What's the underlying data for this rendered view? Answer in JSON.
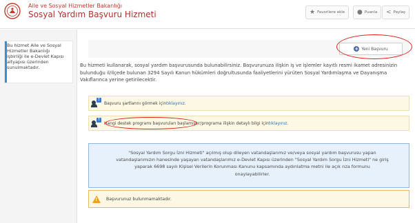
{
  "header": {
    "ministry": "Aile ve Sosyal Hizmetler Bakanlığı",
    "service_title": "Sosyal Yardım Başvuru Hizmeti",
    "buttons": [
      {
        "label": "Favorilere ekle",
        "icon": "star-icon"
      },
      {
        "label": "Puanla",
        "icon": "chat-icon"
      },
      {
        "label": "Paylaş",
        "icon": "share-icon"
      }
    ]
  },
  "sidebar": {
    "info_lines": [
      "Bu hizmet Aile ve Sosyal",
      "Hizmetler Bakanlığı",
      "işbirliği ile e-Devlet Kapısı",
      "altyapısı üzerinden",
      "sunulmaktadır."
    ]
  },
  "main": {
    "new_application_button": "Yeni Başvuru",
    "intro_lines": [
      "Bu hizmeti kullanarak, sosyal yardım başvurusunda bulunabilirsiniz. Başvurunuza ilişkin iş ve işlemler kayıtlı resmi ikamet adresinizin",
      "bulunduğu il/ilçede bulunan 3294 Sayılı Kanun hükümleri doğrultusunda faaliyetlerini yürüten Sosyal Yardımlaşma ve Dayanışma",
      "Vakıflarınca yerine getirilecektir."
    ],
    "notes": [
      {
        "text": "Başvuru şartlarını görmek için ",
        "link": "tıklayınız."
      },
      {
        "text": "Hangi destek programı başvuruları başlamıştır/programa ilişkin detaylı bilgi için ",
        "link": "tıklayınız."
      }
    ],
    "consent_lines": [
      "\"Sosyal Yardım Sorgu İzni Hizmeti\" açılmış olup dileyen vatandaşlarımız ve/veya sosyal yardım başvurusu yapan",
      "vatandaşlarımızın hanesinde yaşayan vatandaşlarımız e-Devlet Kapısı üzerinden \"Sosyal Yardım Sorgu İzni Hizmeti\" ne giriş",
      "yaparak 6698 sayılı Kişisel Verilerin Korunması Kanunu kapsamında aydınlatma metni ile açık rıza formunu",
      "onaylayabilirler."
    ],
    "warning": "Başvurunuz bulunmamaktadır."
  },
  "colors": {
    "brand_red": "#b03030",
    "annotation_red": "#e02020",
    "info_blue_bg": "#e7f1fb",
    "note_yellow_bg": "#fcf8e3",
    "warning_orange": "#f0a020"
  }
}
